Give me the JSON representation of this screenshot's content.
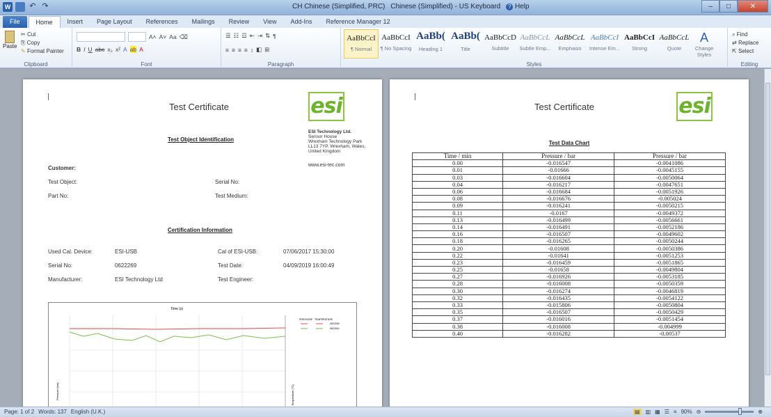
{
  "titlebar": {
    "ime_lang": "CH Chinese (Simplified, PRC)",
    "ime_keyboard": "Chinese (Simplified) - US Keyboard",
    "help": "Help"
  },
  "tabs": [
    "File",
    "Home",
    "Insert",
    "Page Layout",
    "References",
    "Mailings",
    "Review",
    "View",
    "Add-Ins",
    "Reference Manager 12"
  ],
  "ribbon": {
    "clipboard": {
      "paste": "Paste",
      "cut": "Cut",
      "copy": "Copy",
      "format_painter": "Format Painter",
      "label": "Clipboard"
    },
    "font": {
      "label": "Font"
    },
    "paragraph": {
      "label": "Paragraph"
    },
    "styles": {
      "label": "Styles",
      "items": [
        {
          "sample": "AaBbCcI",
          "name": "¶ Normal"
        },
        {
          "sample": "AaBbCcI",
          "name": "¶ No Spacing"
        },
        {
          "sample": "AaBb(",
          "name": "Heading 1"
        },
        {
          "sample": "AaBb(",
          "name": "Title"
        },
        {
          "sample": "AaBbCcD",
          "name": "Subtitle"
        },
        {
          "sample": "AaBbCcL",
          "name": "Subtle Emp..."
        },
        {
          "sample": "AaBbCcL",
          "name": "Emphasis"
        },
        {
          "sample": "AaBbCcI",
          "name": "Intense Em..."
        },
        {
          "sample": "AaBbCcI",
          "name": "Strong"
        },
        {
          "sample": "AaBbCcL",
          "name": "Quote"
        }
      ],
      "change_styles": "Change Styles"
    },
    "editing": {
      "find": "Find",
      "replace": "Replace",
      "select": "Select",
      "label": "Editing"
    }
  },
  "page1": {
    "title": "Test Certificate",
    "logo": "esi",
    "company": {
      "name": "ESI Technology Ltd.",
      "line1": "Sensor House",
      "line2": "Wrexham Technology Park",
      "line3": "LL13 7YP, Wrexham, Wales,",
      "line4": "United Kingdom",
      "web": "www.esi-tec.com"
    },
    "test_object_heading": "Test Object Identification",
    "customer_label": "Customer:",
    "test_object_label": "Test Object:",
    "serial_no_label": "Serial No:",
    "part_no_label": "Part No:",
    "test_medium_label": "Test Medium:",
    "cert_info_heading": "Certification Information",
    "used_cal_label": "Used Cal. Device:",
    "used_cal_value": "ESI-USB",
    "cal_of_label": "Cal of ESI-USB:",
    "cal_of_value": "07/06/2017 15:30:00",
    "serial_label": "Serial No:",
    "serial_value": "0622269",
    "test_date_label": "Test Date:",
    "test_date_value": "04/09/2019 16:00:49",
    "manufacturer_label": "Manufacturer:",
    "manufacturer_value": "ESI Technology Ltd",
    "test_engineer_label": "Test Engineer:",
    "chart": {
      "top_title": "Time (s)",
      "ylabel": "Pressure (bar)",
      "y2label": "Temperature (°C)",
      "legend_hdr1": "PRESSURE",
      "legend_hdr2": "TEMPERATURE",
      "legend_s1": "0622269",
      "legend_s2": "0621814"
    }
  },
  "page2": {
    "title": "Test Certificate",
    "logo": "esi",
    "table_title": "Test Data Chart",
    "headers": [
      "Time / min",
      "Pressure / bar",
      "Pressure / bar"
    ],
    "rows": [
      [
        "0.00",
        "-0.016547",
        "-0.0041086"
      ],
      [
        "0.01",
        "-0.01666",
        "-0.0045155"
      ],
      [
        "0.03",
        "-0.016604",
        "-0.0050064"
      ],
      [
        "0.04",
        "-0.016217",
        "-0.0047651"
      ],
      [
        "0.06",
        "-0.016684",
        "-0.0051926"
      ],
      [
        "0.08",
        "-0.016676",
        "-0.005024"
      ],
      [
        "0.09",
        "-0.016241",
        "-0.0050215"
      ],
      [
        "0.11",
        "-0.0167",
        "-0.0049372"
      ],
      [
        "0.13",
        "-0.016499",
        "-0.0056661"
      ],
      [
        "0.14",
        "-0.016491",
        "-0.0052186"
      ],
      [
        "0.16",
        "-0.016507",
        "-0.0049602"
      ],
      [
        "0.18",
        "-0.016265",
        "-0.0050244"
      ],
      [
        "0.20",
        "-0.01608",
        "-0.0050386"
      ],
      [
        "0.22",
        "-0.01641",
        "-0.0051253"
      ],
      [
        "0.23",
        "-0.016459",
        "-0.0051865"
      ],
      [
        "0.25",
        "-0.01658",
        "-0.0049804"
      ],
      [
        "0.27",
        "-0.016926",
        "-0.0053185"
      ],
      [
        "0.28",
        "-0.016008",
        "-0.0050359"
      ],
      [
        "0.30",
        "-0.016274",
        "-0.0046819"
      ],
      [
        "0.32",
        "-0.016435",
        "-0.0054122"
      ],
      [
        "0.33",
        "-0.015806",
        "-0.0050804"
      ],
      [
        "0.35",
        "-0.016507",
        "-0.0050429"
      ],
      [
        "0.37",
        "-0.016016",
        "-0.0051454"
      ],
      [
        "0.38",
        "-0.016008",
        "-0.004999"
      ],
      [
        "0.40",
        "-0.016282",
        "-0.00537"
      ]
    ]
  },
  "statusbar": {
    "page": "Page: 1 of 2",
    "words": "Words: 137",
    "language": "English (U.K.)",
    "zoom": "90%"
  },
  "colors": {
    "logo_green": "#6fb32c",
    "series1": "#e05050",
    "series2": "#7bbf4a"
  }
}
